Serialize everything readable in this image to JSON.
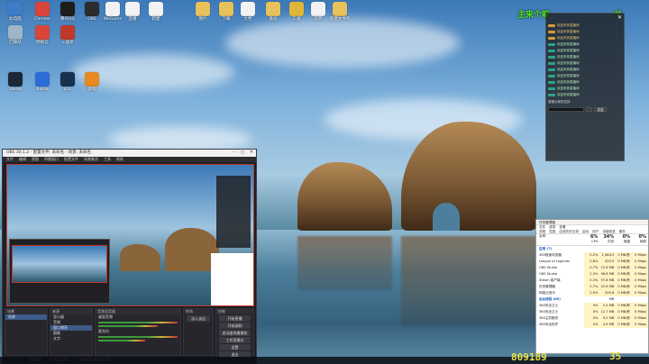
{
  "desktop_icons": [
    {
      "label": "此电脑",
      "icon": "computer-icon",
      "color": "#3d7cc9"
    },
    {
      "label": "Chrome",
      "icon": "chrome-icon",
      "color": "#d9453a"
    },
    {
      "label": "腾讯QQ",
      "icon": "qq-icon",
      "color": "#1d1d1d"
    },
    {
      "label": "OBS",
      "icon": "obs-icon",
      "color": "#2c2c2c"
    },
    {
      "label": "WeGame",
      "icon": "file-icon",
      "color": "#f2f2f2"
    },
    {
      "label": "直播",
      "icon": "file-icon",
      "color": "#f2f2f2"
    },
    {
      "label": "新建",
      "icon": "file-icon",
      "color": "#f2f2f2"
    },
    {
      "label": "图片",
      "icon": "folder-icon",
      "color": "#e7c15a"
    },
    {
      "label": "下载",
      "icon": "folder-icon",
      "color": "#e7c15a"
    },
    {
      "label": "文档",
      "icon": "file-icon",
      "color": "#f2f2f2"
    },
    {
      "label": "备份",
      "icon": "folder-icon",
      "color": "#e7c15a"
    },
    {
      "label": "工具",
      "icon": "tool-icon",
      "color": "#e0b63a"
    },
    {
      "label": "说明",
      "icon": "file-icon",
      "color": "#f2f2f2"
    },
    {
      "label": "新建文件夹",
      "icon": "folder-icon",
      "color": "#e7c15a"
    },
    {
      "label": "回收站",
      "icon": "recycle-bin-icon",
      "color": "#9fb6c8"
    },
    {
      "label": "网易云",
      "icon": "music-icon",
      "color": "#d9453a"
    },
    {
      "label": "三国杀",
      "icon": "game-icon",
      "color": "#c0392b"
    },
    {
      "label": "Steam",
      "icon": "steam-icon",
      "color": "#1b2838"
    },
    {
      "label": "Battle",
      "icon": "battlenet-icon",
      "color": "#2c6cd6"
    },
    {
      "label": "LOL",
      "icon": "lol-icon",
      "color": "#16324f"
    },
    {
      "label": "游戏",
      "icon": "game-icon",
      "color": "#e88a1f"
    }
  ],
  "overlay": {
    "title": "主来个嘛",
    "close": "关"
  },
  "notification": {
    "close": "✕",
    "lines": [
      {
        "text": "欢迎来到直播间",
        "style": "gold"
      },
      {
        "text": "欢迎来到直播间",
        "style": "gold"
      },
      {
        "text": "欢迎来到直播间",
        "style": "gold"
      },
      {
        "text": "欢迎来到直播间",
        "style": "green"
      },
      {
        "text": "欢迎来到直播间",
        "style": "green"
      },
      {
        "text": "欢迎来到直播间",
        "style": "green"
      },
      {
        "text": "欢迎来到直播间",
        "style": "green"
      },
      {
        "text": "欢迎来到直播间",
        "style": "green"
      },
      {
        "text": "欢迎来到直播间",
        "style": "green"
      },
      {
        "text": "欢迎来到直播间",
        "style": "green"
      },
      {
        "text": "欢迎来到直播间",
        "style": "green"
      },
      {
        "text": "欢迎来到直播间",
        "style": "green"
      }
    ],
    "footer": "感谢大家的支持",
    "send": "发送"
  },
  "obs": {
    "title": "OBS 30.1.2 - 配置文件: 未命名 - 场景: 未命名",
    "menu": [
      "文件",
      "编辑",
      "视图",
      "停靠窗口",
      "配置文件",
      "场景集合",
      "工具",
      "帮助"
    ],
    "docks": {
      "scenes": {
        "title": "场景",
        "items": [
          "场景"
        ]
      },
      "sources": {
        "title": "来源",
        "items": [
          "显示器",
          "音频",
          "窗口捕获",
          "图像",
          "文字"
        ]
      },
      "mixer": {
        "title": "音频混音器",
        "items": [
          "桌面音频",
          "麦克风"
        ]
      },
      "transitions": {
        "title": "转场",
        "value": "淡入淡出"
      },
      "controls": {
        "title": "控制",
        "buttons": [
          "开始直播",
          "开始录制",
          "启动虚拟摄像机",
          "工作室模式",
          "设置",
          "退出"
        ]
      }
    },
    "status": [
      "帧 0/0",
      "CPU 3.2%",
      "60.00 / 60.00 FPS"
    ]
  },
  "taskmgr": {
    "title": "任务管理器",
    "menu": [
      "文件",
      "选项",
      "查看"
    ],
    "tabs": [
      "进程",
      "性能",
      "应用历史记录",
      "启动",
      "用户",
      "详细信息",
      "服务"
    ],
    "columns": [
      {
        "pct": "",
        "name": "名称"
      },
      {
        "pct": "6%",
        "name": "CPU"
      },
      {
        "pct": "34%",
        "name": "内存"
      },
      {
        "pct": "0%",
        "name": "磁盘"
      },
      {
        "pct": "0%",
        "name": "网络"
      }
    ],
    "sections": [
      {
        "title": "应用 (7)",
        "rows": [
          {
            "name": "360极速浏览器",
            "cpu": "0.2%",
            "mem": "1,464.5 MB",
            "disk": "0 MB/秒",
            "net": "0 Mbps"
          },
          {
            "name": "League of Legends",
            "cpu": "0.8%",
            "mem": "420.5 MB",
            "disk": "0 MB/秒",
            "net": "0 Mbps"
          },
          {
            "name": "OBS Studio",
            "cpu": "0.7%",
            "mem": "12.6 MB",
            "disk": "0 MB/秒",
            "net": "0 Mbps"
          },
          {
            "name": "OBS Studio",
            "cpu": "1.0%",
            "mem": "96.8 MB",
            "disk": "0 MB/秒",
            "net": "0 Mbps"
          },
          {
            "name": "Steam 客户端",
            "cpu": "0.3%",
            "mem": "97.8 MB",
            "disk": "0 MB/秒",
            "net": "0 Mbps"
          },
          {
            "name": "任务管理器",
            "cpu": "0.7%",
            "mem": "22.6 MB",
            "disk": "0 MB/秒",
            "net": "0 Mbps"
          },
          {
            "name": "网易云音乐",
            "cpu": "2.0%",
            "mem": "200.8 MB",
            "disk": "0 MB/秒",
            "net": "0 Mbps"
          }
        ]
      },
      {
        "title": "后台进程 (89)",
        "rows": [
          {
            "name": "360安全卫士",
            "cpu": "0%",
            "mem": "2.5 MB",
            "disk": "0 MB/秒",
            "net": "0 Mbps"
          },
          {
            "name": "360安全卫士",
            "cpu": "0%",
            "mem": "12.7 MB",
            "disk": "0 MB/秒",
            "net": "0 Mbps"
          },
          {
            "name": "360主防服务",
            "cpu": "0%",
            "mem": "9.2 MB",
            "disk": "0 MB/秒",
            "net": "0 Mbps"
          },
          {
            "name": "360安全防护",
            "cpu": "0%",
            "mem": "4.6 MB",
            "disk": "0 MB/秒",
            "net": "0 Mbps"
          }
        ]
      }
    ]
  },
  "counter": "809189",
  "counter_right": "35"
}
